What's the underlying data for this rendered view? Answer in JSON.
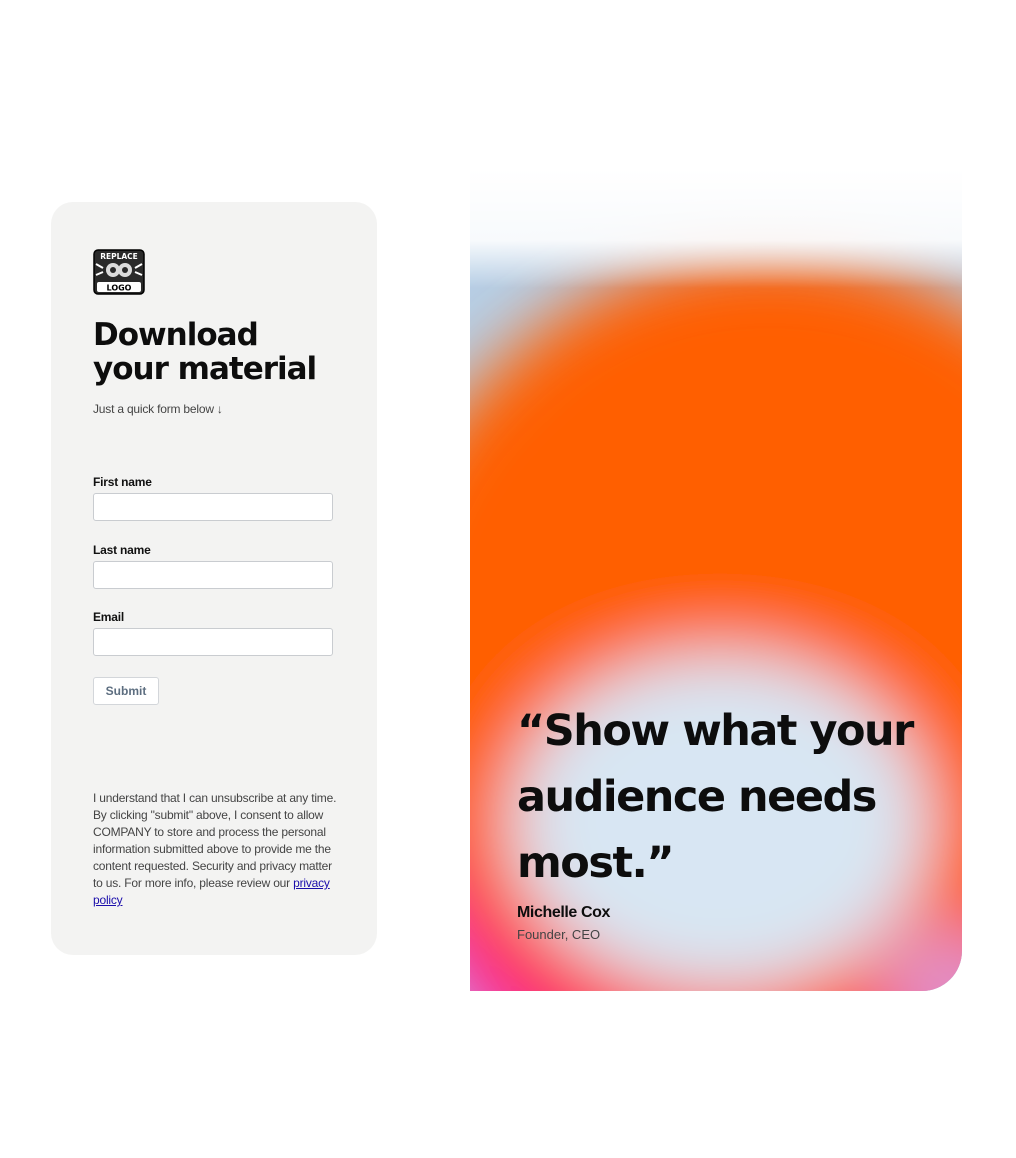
{
  "logo": {
    "line1": "REPLACE",
    "line2": "LOGO"
  },
  "form": {
    "title_line1": "Download",
    "title_line2": "your material",
    "subtitle": "Just a quick form below ↓",
    "fields": [
      {
        "label": "First name",
        "value": "",
        "placeholder": ""
      },
      {
        "label": "Last name",
        "value": "",
        "placeholder": ""
      },
      {
        "label": "Email",
        "value": "",
        "placeholder": ""
      }
    ],
    "submit_label": "Submit",
    "consent_text": "I understand that I can unsubscribe at any time. By clicking \"submit\" above, I consent to allow COMPANY to store and process the personal information submitted above to provide me the content requested. Security and privacy matter to us. For more info, please review our",
    "privacy_link": "privacy policy"
  },
  "testimonial": {
    "quote_line1": "“Show what your",
    "quote_line2": "audience needs",
    "quote_line3": "most.”",
    "author_name": "Michelle Cox",
    "author_title": "Founder, CEO"
  },
  "colors": {
    "card_bg": "#f3f3f2",
    "accent_orange": "#ff4a00",
    "accent_pink": "#ff1f6d",
    "accent_purple": "#e050d8",
    "accent_blue": "#b6cfe6",
    "link": "#1a0dab"
  }
}
